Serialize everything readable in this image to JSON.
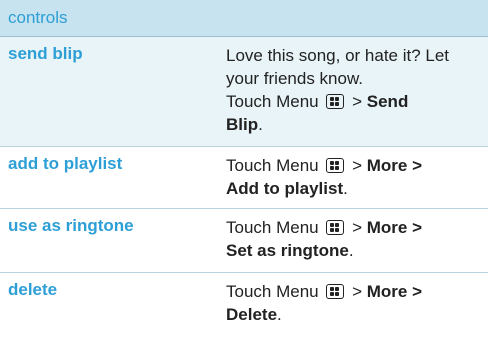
{
  "header": {
    "title": "controls"
  },
  "rows": [
    {
      "action": "send blip",
      "description": "Love this song, or hate it? Let your friends know.",
      "touch": "Touch Menu",
      "sep": ">",
      "target_line1": "Send",
      "target_line2": "Blip",
      "end": "."
    },
    {
      "action": "add to playlist",
      "touch": "Touch Menu",
      "sep": ">",
      "target_line1": "More >",
      "target_line2": "Add to playlist",
      "end": "."
    },
    {
      "action": "use as ringtone",
      "touch": "Touch Menu",
      "sep": ">",
      "target_line1": "More >",
      "target_line2": "Set as ringtone",
      "end": "."
    },
    {
      "action": "delete",
      "touch": "Touch Menu",
      "sep": ">",
      "target_line1": "More >",
      "target_line2": "Delete",
      "end": "."
    }
  ],
  "icons": {
    "menu_key": "menu-key-icon"
  }
}
